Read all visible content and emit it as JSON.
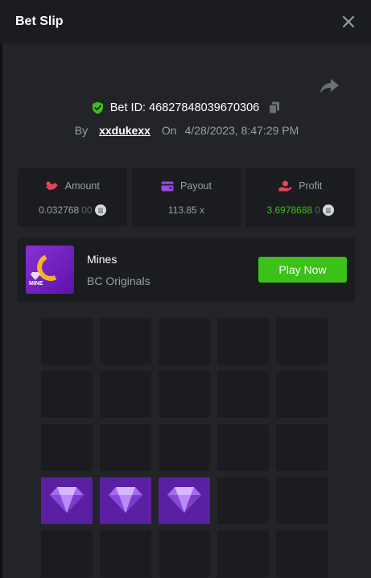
{
  "header": {
    "title": "Bet Slip"
  },
  "bet": {
    "id_text": "Bet ID: 46827848039670306",
    "by_label": "By",
    "username": "xxdukexx",
    "on_label": "On",
    "datetime": "4/28/2023, 8:47:29 PM"
  },
  "stats": {
    "amount": {
      "label": "Amount",
      "value_main": "0.032768",
      "value_dim": "00"
    },
    "payout": {
      "label": "Payout",
      "value": "113.85 x"
    },
    "profit": {
      "label": "Profit",
      "value_main": "3.6978688",
      "value_dim": "0"
    }
  },
  "game": {
    "name": "Mines",
    "provider": "BC Originals",
    "thumb_label": "MINE",
    "play_label": "Play Now"
  },
  "colors": {
    "accent_green": "#3bc117",
    "gem_tile": "#5b1fa3",
    "panel": "#1b1c1f"
  },
  "grid": {
    "rows": 5,
    "cols": 5,
    "tiles": [
      "empty",
      "empty",
      "empty",
      "empty",
      "empty",
      "empty",
      "empty",
      "empty",
      "empty",
      "empty",
      "empty",
      "empty",
      "empty",
      "empty",
      "empty",
      "gem",
      "gem",
      "gem",
      "empty",
      "empty",
      "empty",
      "empty",
      "empty",
      "empty",
      "empty"
    ]
  }
}
